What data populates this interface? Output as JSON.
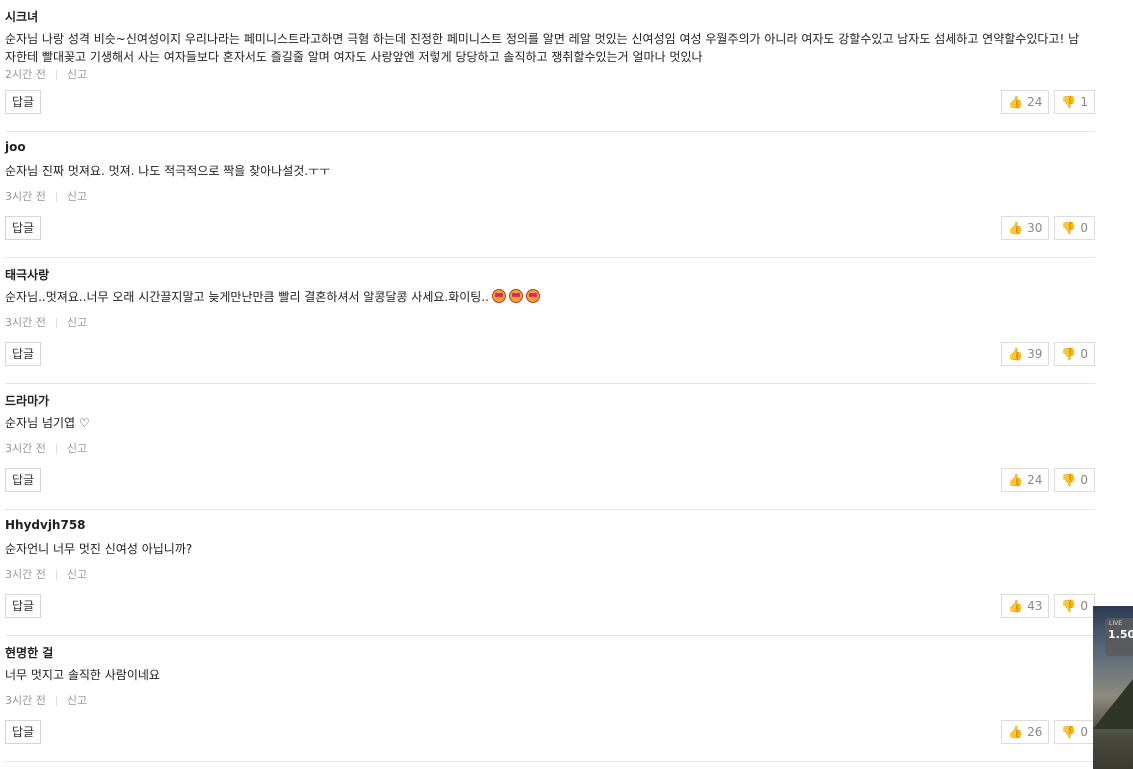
{
  "comments": [
    {
      "author": "시크녀",
      "text": "순자님 나랑 성격 비슷~신여성이지 우리나라는 페미니스트라고하면 극혐 하는데 진정한 페미니스트 정의를 알면 레알 멋있는 신여성임 여성 우월주의가 아니라 여자도 강할수있고 남자도 섬세하고 연약할수있다고! 남자한테 빨대꽂고 기생해서 사는 여자들보다 혼자서도 즐길줄 알며 여자도 사랑앞엔 저렇게 당당하고 솔직하고 쟁취할수있는거 얼마나 멋있나",
      "time": "2시간 전",
      "report": "신고",
      "reply": "답글",
      "likes": "24",
      "dislikes": "1"
    },
    {
      "author": "joo",
      "text": "순자님 진짜 멋져요. 멋져. 나도 적극적으로 짝을 찾아나설것.ㅜㅜ",
      "time": "3시간 전",
      "report": "신고",
      "reply": "답글",
      "likes": "30",
      "dislikes": "0"
    },
    {
      "author": "태극사랑",
      "text": "순자님..멋져요..너무 오래 시간끌지말고 늦게만난만큼 빨리 결혼하셔서 알콩달콩 사세요.화이팅..",
      "time": "3시간 전",
      "report": "신고",
      "reply": "답글",
      "likes": "39",
      "dislikes": "0"
    },
    {
      "author": "드라마가",
      "text": "순자님 넘기엽 ♡",
      "time": "3시간 전",
      "report": "신고",
      "reply": "답글",
      "likes": "24",
      "dislikes": "0"
    },
    {
      "author": "Hhydvjh758",
      "text": "순자언니 너무 멋진 신여성 아닙니까?",
      "time": "3시간 전",
      "report": "신고",
      "reply": "답글",
      "likes": "43",
      "dislikes": "0"
    },
    {
      "author": "현명한 걸",
      "text": "너무 멋지고 솔직한 사람이네요",
      "time": "3시간 전",
      "report": "신고",
      "reply": "답글",
      "likes": "26",
      "dislikes": "0"
    }
  ],
  "video_overlay": {
    "label": "1.50",
    "small_label": "LIVE"
  },
  "icons": {
    "like": "thumbs-up-icon",
    "dislike": "thumbs-down-icon",
    "emoji": "heart-eyes-emoji-icon"
  },
  "colors": {
    "meta": "#999999",
    "border": "#dddddd",
    "thumb": "#d9a98c"
  }
}
